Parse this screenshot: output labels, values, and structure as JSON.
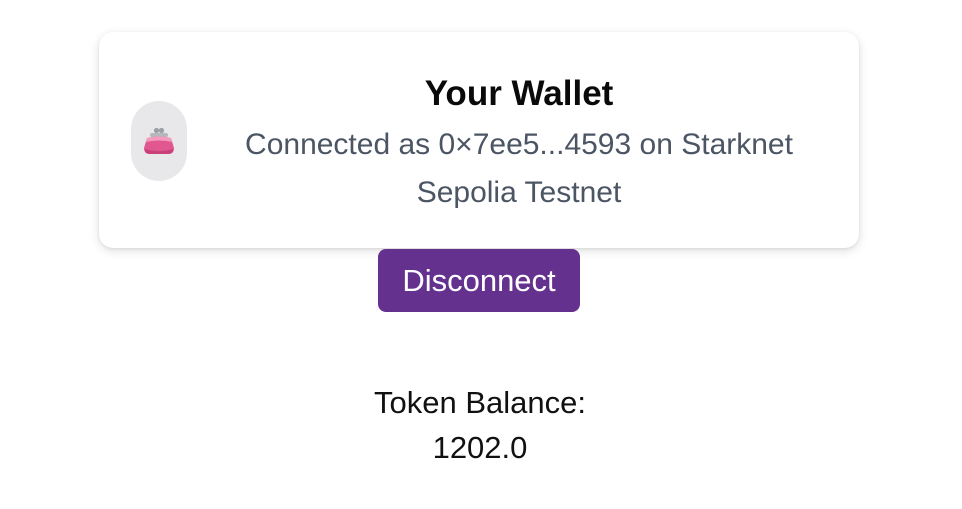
{
  "wallet": {
    "title": "Your Wallet",
    "subtitle": "Connected as 0×7ee5...4593 on Starknet Sepolia Testnet",
    "icon": "purse-icon"
  },
  "actions": {
    "disconnect_label": "Disconnect"
  },
  "token": {
    "balance_label": "Token Balance:",
    "balance_value": "1202.0"
  },
  "colors": {
    "button_bg": "#65318f",
    "subtitle_text": "#4b5563",
    "avatar_bg": "#e8e8eb"
  }
}
